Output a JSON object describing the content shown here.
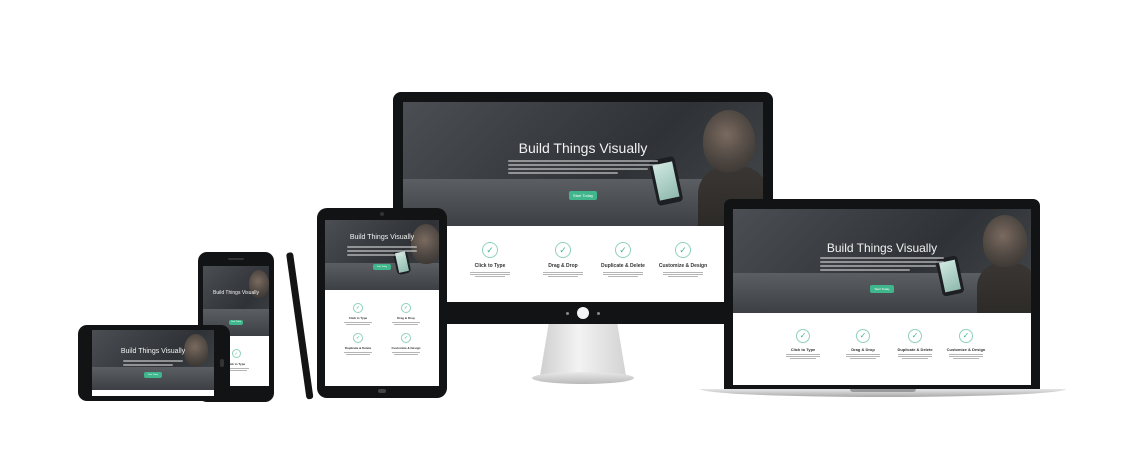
{
  "hero": {
    "title": "Build Things Visually",
    "cta_label": "Start Today"
  },
  "features": [
    {
      "title": "Click to Type",
      "icon": "check-circle-icon"
    },
    {
      "title": "Drag & Drop",
      "icon": "check-circle-icon"
    },
    {
      "title": "Duplicate & Delete",
      "icon": "check-circle-icon"
    },
    {
      "title": "Customize & Design",
      "icon": "check-circle-icon"
    }
  ],
  "tablet_features": [
    {
      "title": "Click to Type"
    },
    {
      "title": "Drag & Drop"
    },
    {
      "title": "Duplicate & Delete"
    },
    {
      "title": "Customize & Design"
    }
  ],
  "colors": {
    "accent": "#3fb68b",
    "device_bezel": "#121314",
    "stand": "#d8d8d8"
  },
  "icons": {
    "check": "✓"
  }
}
